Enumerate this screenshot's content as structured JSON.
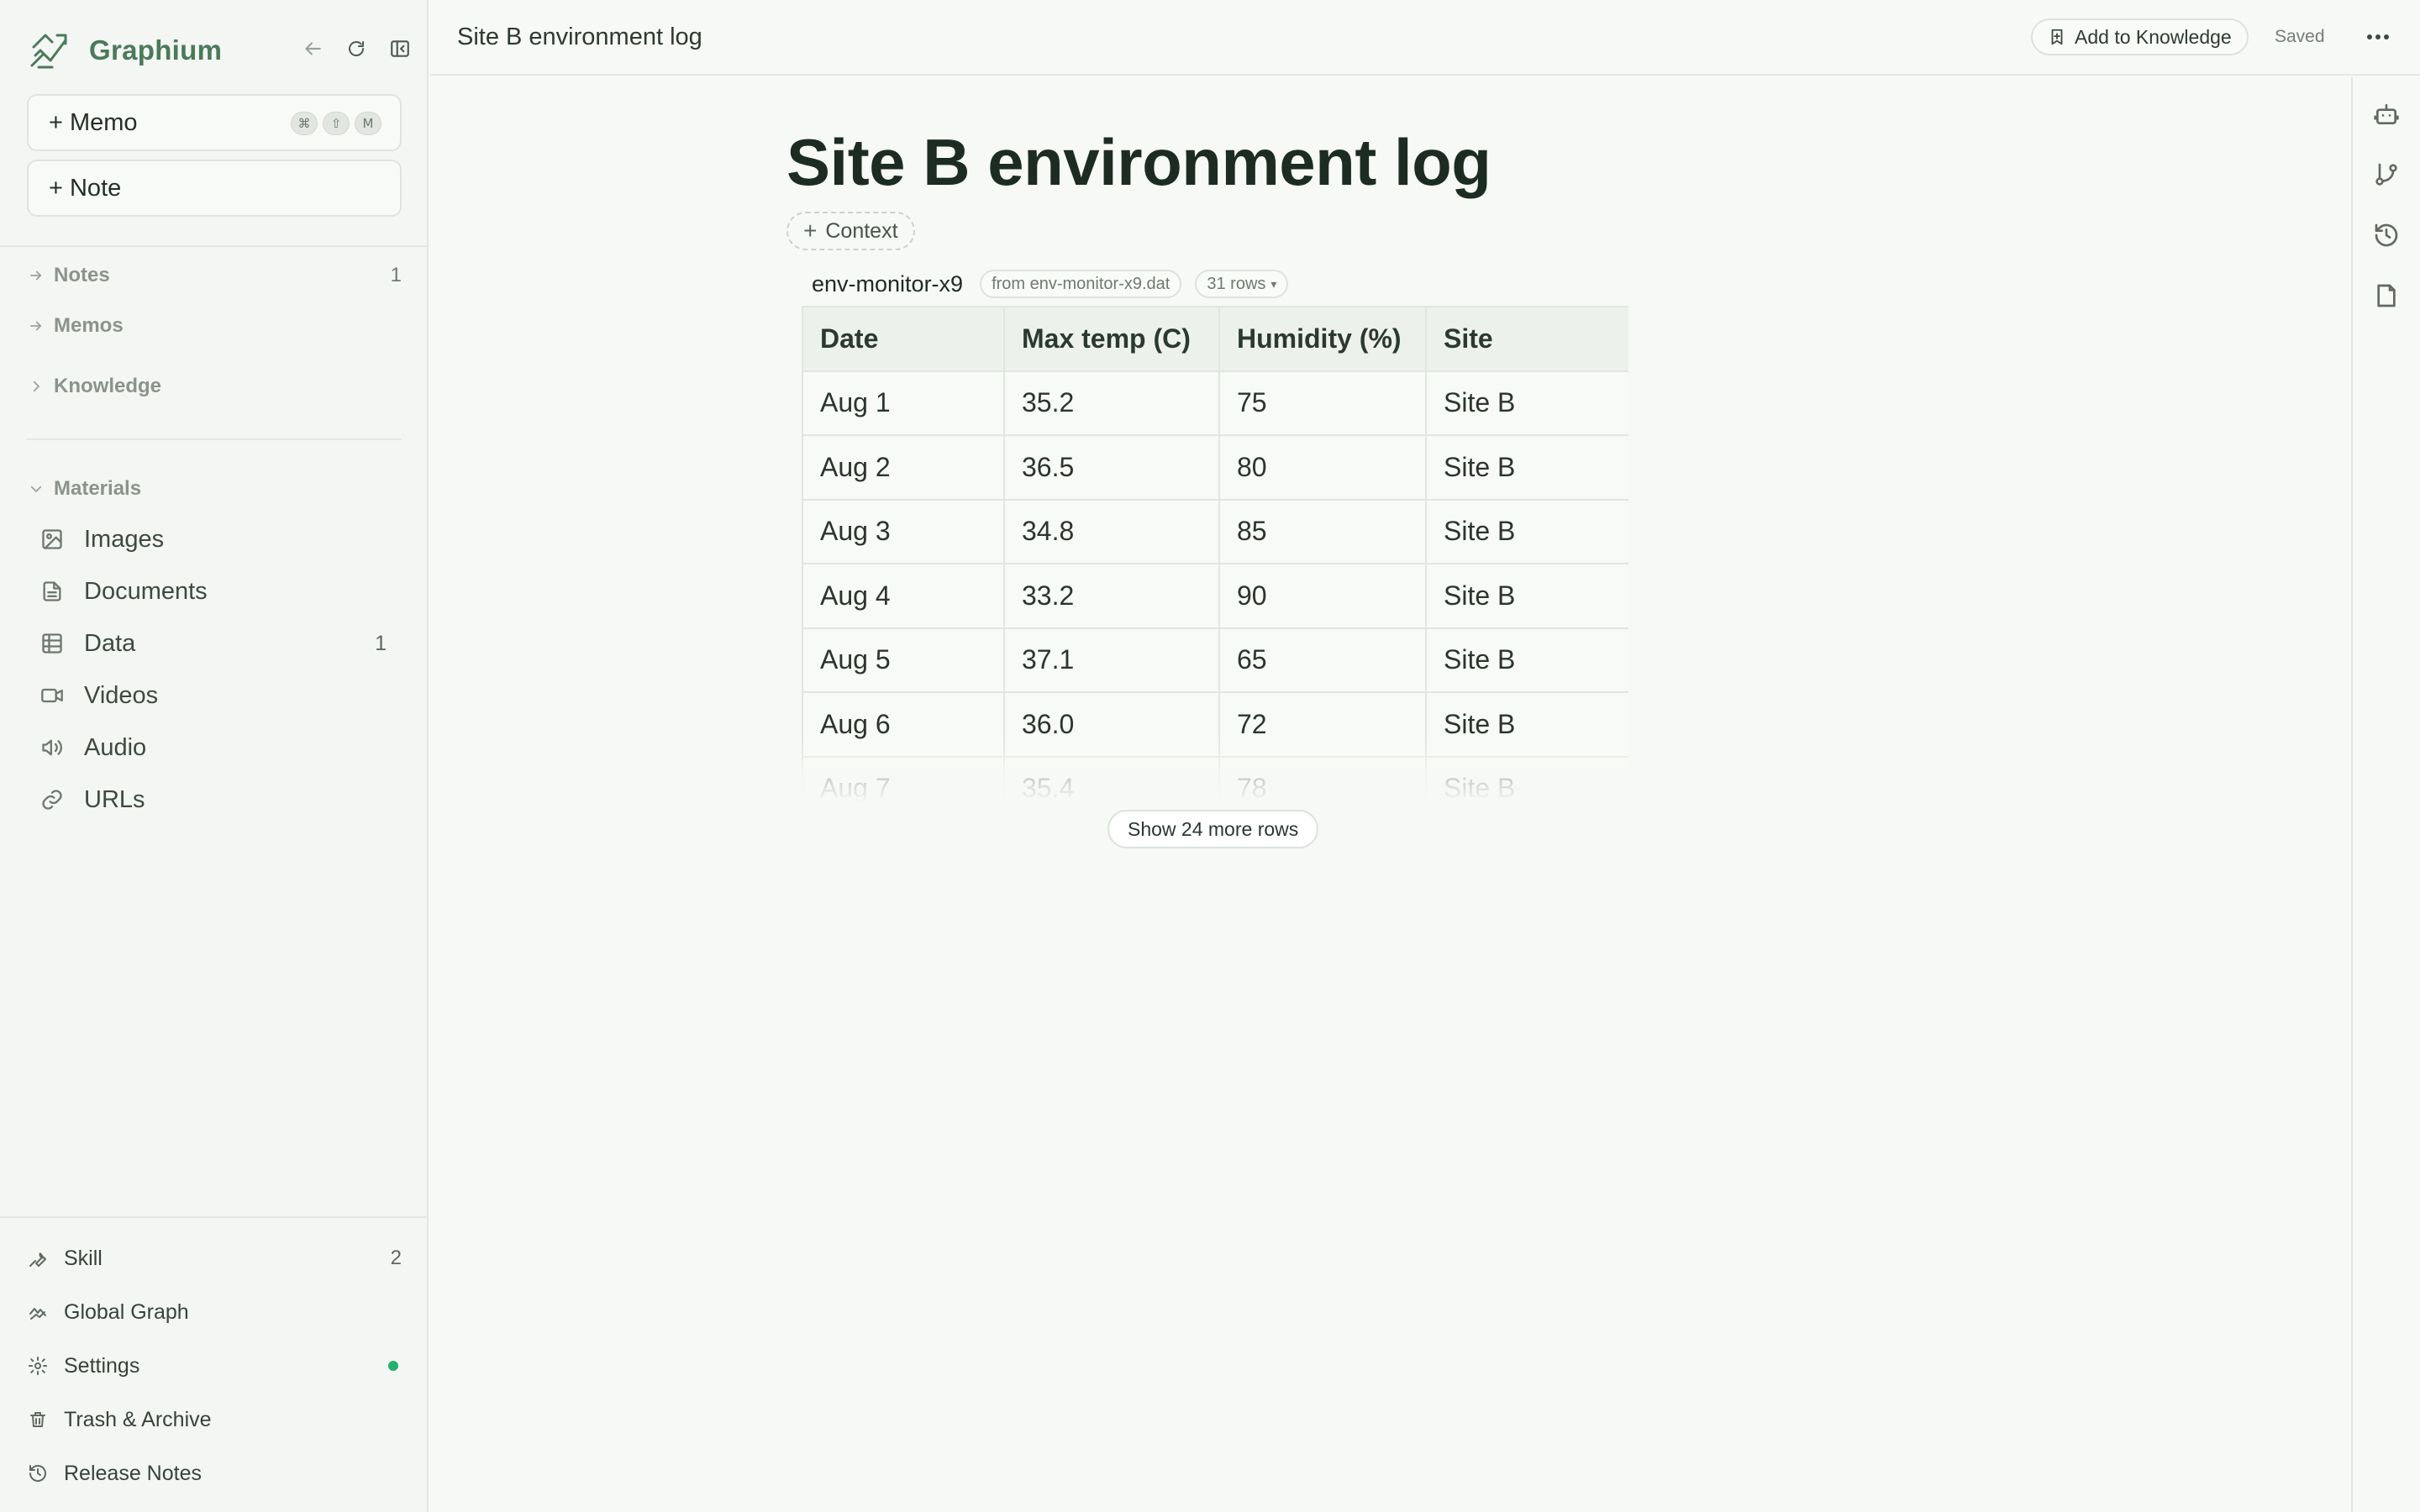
{
  "app": {
    "name": "Graphium",
    "accent_color": "#4a7a5a",
    "status_dot_color": "#25b06d"
  },
  "sidebar": {
    "memo_button": "+ Memo",
    "memo_shortcut": [
      "⌘",
      "⇧",
      "M"
    ],
    "note_button": "+ Note",
    "sections": [
      {
        "label": "Notes",
        "count": "1",
        "icon": "arrow-right-icon"
      },
      {
        "label": "Memos",
        "count": "",
        "icon": "arrow-right-icon"
      },
      {
        "label": "Knowledge",
        "count": "",
        "icon": "chevron-right-icon"
      }
    ],
    "materials": {
      "label": "Materials",
      "items": [
        {
          "label": "Images",
          "count": "",
          "icon": "image-icon"
        },
        {
          "label": "Documents",
          "count": "",
          "icon": "document-icon"
        },
        {
          "label": "Data",
          "count": "1",
          "icon": "table-icon"
        },
        {
          "label": "Videos",
          "count": "",
          "icon": "video-icon"
        },
        {
          "label": "Audio",
          "count": "",
          "icon": "speaker-icon"
        },
        {
          "label": "URLs",
          "count": "",
          "icon": "link-icon"
        }
      ]
    },
    "footer": [
      {
        "label": "Skill",
        "count": "2",
        "icon": "wrench-icon"
      },
      {
        "label": "Global Graph",
        "count": "",
        "icon": "graph-icon"
      },
      {
        "label": "Settings",
        "count": "",
        "icon": "gear-icon",
        "status_dot": true
      },
      {
        "label": "Trash & Archive",
        "count": "",
        "icon": "trash-icon"
      },
      {
        "label": "Release Notes",
        "count": "",
        "icon": "history-icon"
      }
    ]
  },
  "topbar": {
    "breadcrumb": "Site B environment log",
    "add_to_knowledge": "Add to Knowledge",
    "save_status": "Saved"
  },
  "document": {
    "title": "Site B environment log",
    "context_button": "Context",
    "dataset": {
      "name": "env-monitor-x9",
      "source": "from env-monitor-x9.dat",
      "rows_badge": "31 rows",
      "columns": [
        "Date",
        "Max temp (C)",
        "Humidity (%)",
        "Site"
      ],
      "rows": [
        [
          "Aug 1",
          "35.2",
          "75",
          "Site B"
        ],
        [
          "Aug 2",
          "36.5",
          "80",
          "Site B"
        ],
        [
          "Aug 3",
          "34.8",
          "85",
          "Site B"
        ],
        [
          "Aug 4",
          "33.2",
          "90",
          "Site B"
        ],
        [
          "Aug 5",
          "37.1",
          "65",
          "Site B"
        ],
        [
          "Aug 6",
          "36.0",
          "72",
          "Site B"
        ],
        [
          "Aug 7",
          "35.4",
          "78",
          "Site B"
        ]
      ],
      "show_more": "Show 24 more rows"
    }
  },
  "right_rail": [
    "robot-icon",
    "branch-icon",
    "history-icon",
    "page-icon"
  ]
}
